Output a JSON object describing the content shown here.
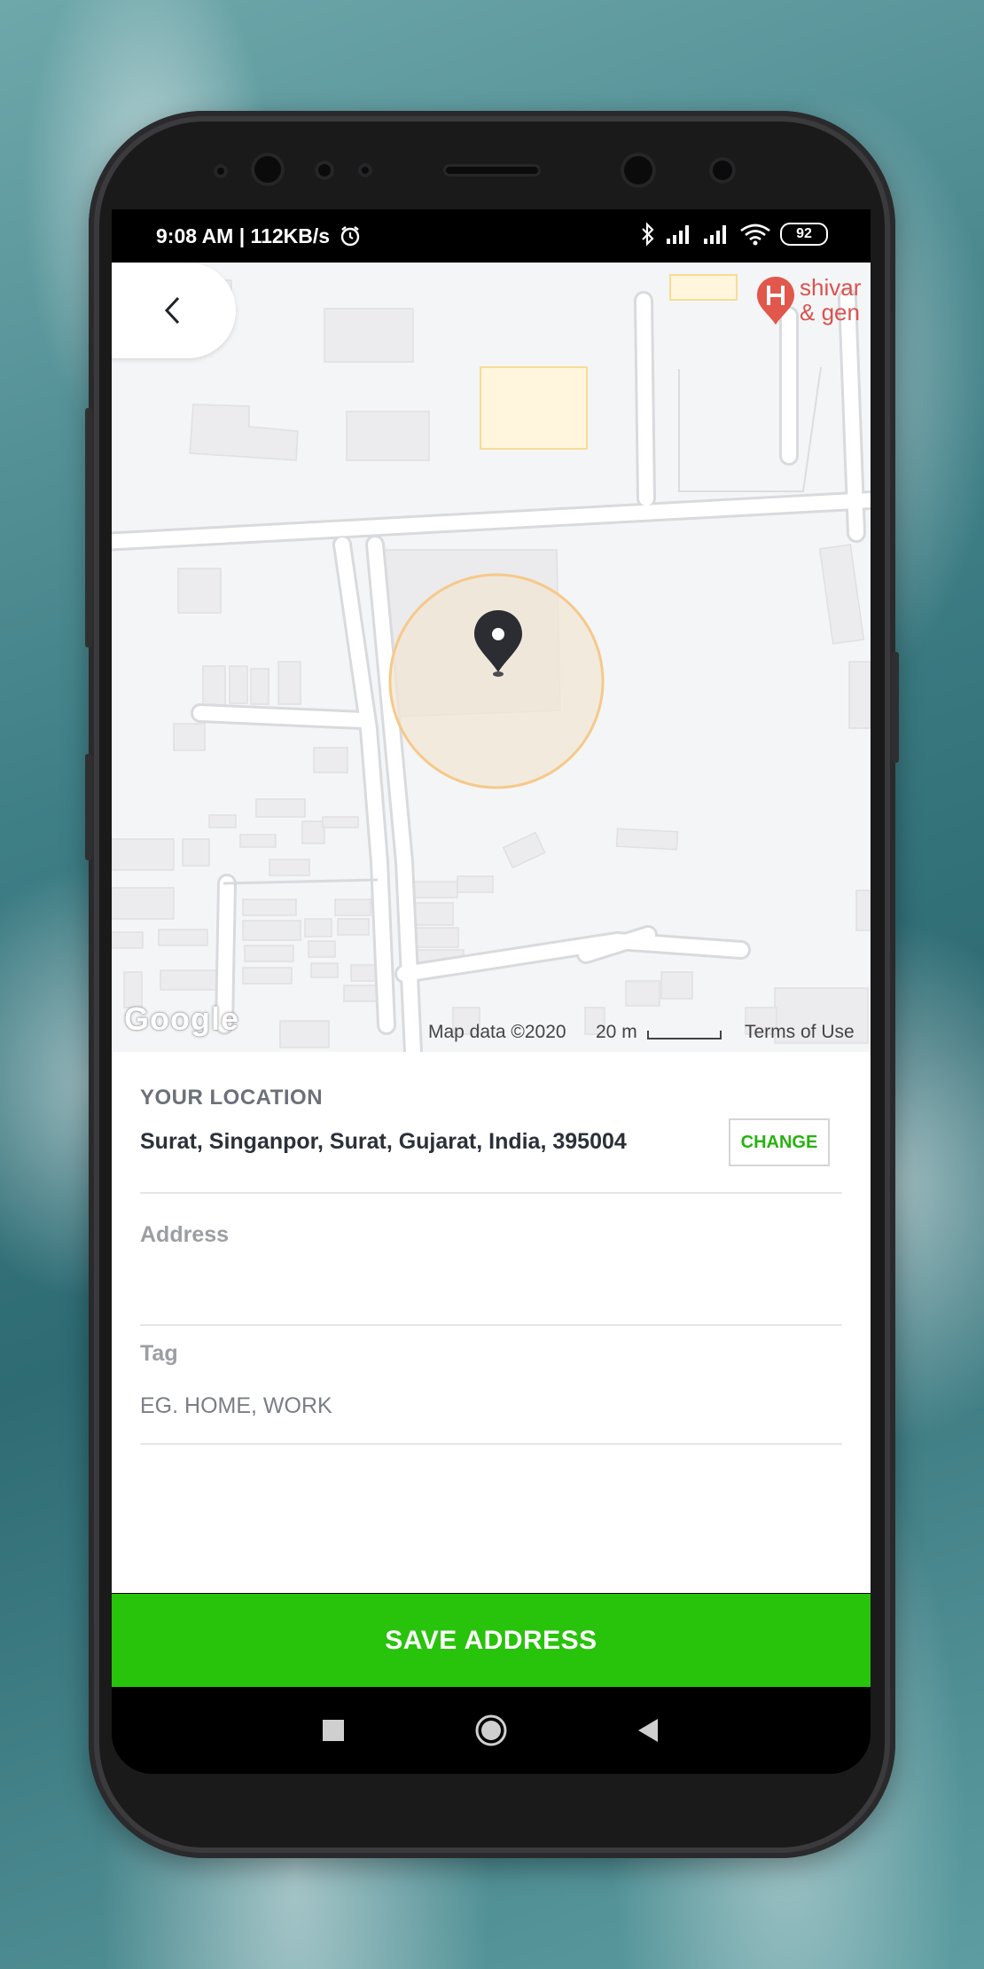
{
  "status_bar": {
    "time_speed": "9:08 AM | 112KB/s",
    "battery": "92",
    "icons": [
      "alarm-icon",
      "bluetooth-icon",
      "signal-icon",
      "signal-icon",
      "wifi-icon",
      "battery-icon"
    ]
  },
  "map": {
    "poi_label_line1": "shivar",
    "poi_label_line2": "& gen",
    "google_logo": "Google",
    "map_data": "Map data ©2020",
    "scale": "20 m",
    "terms": "Terms of Use",
    "colors": {
      "radius_fill": "#f2e6d4",
      "radius_stroke": "#f6c98a",
      "pin": "#2b2d33",
      "poi": "#e2574c"
    }
  },
  "location": {
    "title": "YOUR LOCATION",
    "value": "Surat, Singanpor, Surat, Gujarat, India, 395004",
    "change_label": "CHANGE"
  },
  "address": {
    "label": "Address",
    "value": "",
    "placeholder": ""
  },
  "tag": {
    "label": "Tag",
    "value": "",
    "placeholder": "EG. HOME, WORK"
  },
  "save_label": "SAVE ADDRESS",
  "colors": {
    "accent": "#28c30b",
    "change_text": "#27b20f"
  }
}
